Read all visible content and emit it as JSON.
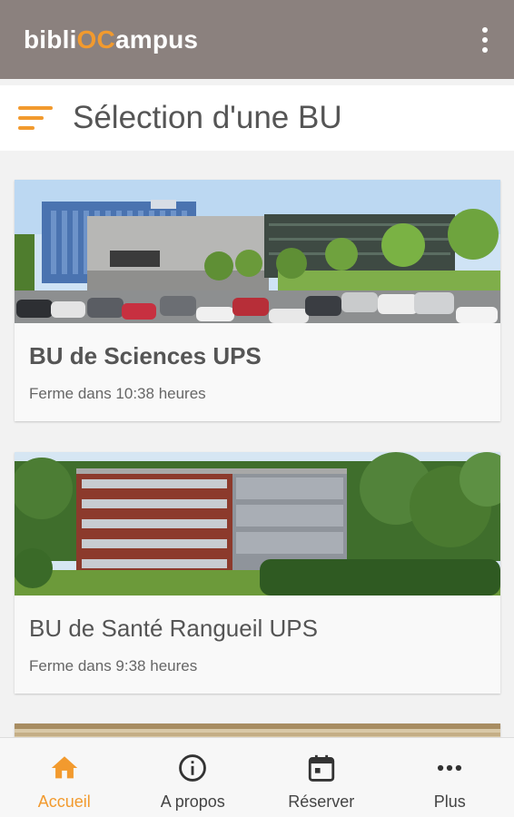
{
  "appbar": {
    "logo_part1": "bibli",
    "logo_part2": "OC",
    "logo_part3": "ampus",
    "overflow_icon": "more-vert-icon"
  },
  "header": {
    "title": "Sélection d'une BU",
    "sort_icon": "sort-icon"
  },
  "libraries": [
    {
      "name": "BU de Sciences UPS",
      "status": "Ferme dans 10:38 heures"
    },
    {
      "name": "BU de Santé Rangueil UPS",
      "status": "Ferme dans 9:38 heures"
    }
  ],
  "bottom_nav": [
    {
      "label": "Accueil",
      "icon": "home-icon",
      "active": true
    },
    {
      "label": "A propos",
      "icon": "info-icon",
      "active": false
    },
    {
      "label": "Réserver",
      "icon": "calendar-icon",
      "active": false
    },
    {
      "label": "Plus",
      "icon": "more-horiz-icon",
      "active": false
    }
  ],
  "colors": {
    "appbar": "#8b817e",
    "accent": "#f29a2e",
    "text": "#555555"
  }
}
